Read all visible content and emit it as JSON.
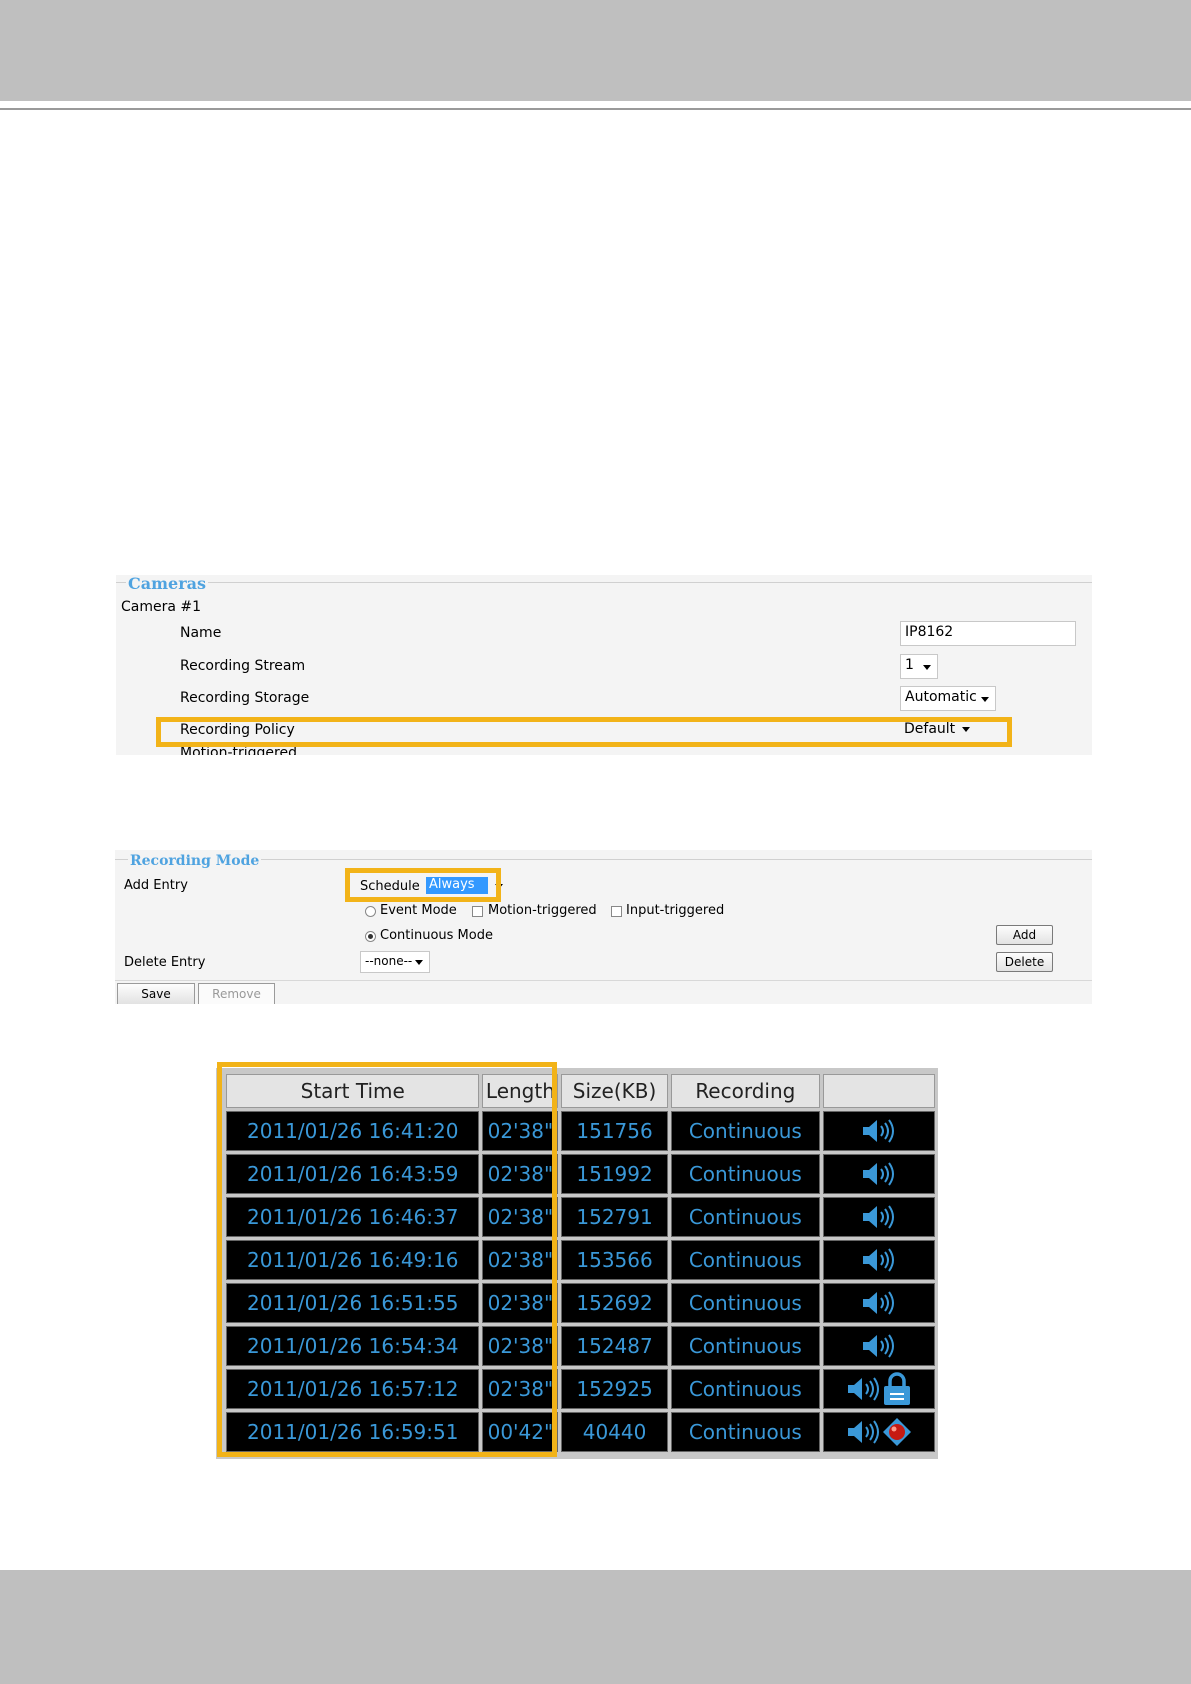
{
  "cameras_panel": {
    "legend": "Cameras",
    "camera_title": "Camera #1",
    "rows": [
      {
        "label": "Name",
        "value": "IP8162"
      },
      {
        "label": "Recording Stream",
        "value": "1"
      },
      {
        "label": "Recording Storage",
        "value": "Automatic"
      },
      {
        "label": "Recording Policy",
        "value": "Default"
      }
    ],
    "cut_off_text": "Motion-triggered"
  },
  "recording_mode_panel": {
    "legend": "Recording Mode",
    "add_entry_label": "Add Entry",
    "schedule_label": "Schedule",
    "schedule_value": "Always",
    "event_mode_label": "Event Mode",
    "motion_triggered_label": "Motion-triggered",
    "input_triggered_label": "Input-triggered",
    "continuous_mode_label": "Continuous Mode",
    "delete_entry_label": "Delete Entry",
    "delete_select_value": "--none--",
    "add_button": "Add",
    "delete_button": "Delete",
    "save_tab": "Save",
    "remove_tab": "Remove"
  },
  "recordings_table": {
    "headers": [
      "Start Time",
      "Length",
      "Size(KB)",
      "Recording",
      ""
    ],
    "rows": [
      {
        "start_time": "2011/01/26 16:41:20",
        "length": "02'38\"",
        "size_kb": "151756",
        "recording": "Continuous",
        "icons": [
          "speaker-icon"
        ]
      },
      {
        "start_time": "2011/01/26 16:43:59",
        "length": "02'38\"",
        "size_kb": "151992",
        "recording": "Continuous",
        "icons": [
          "speaker-icon"
        ]
      },
      {
        "start_time": "2011/01/26 16:46:37",
        "length": "02'38\"",
        "size_kb": "152791",
        "recording": "Continuous",
        "icons": [
          "speaker-icon"
        ]
      },
      {
        "start_time": "2011/01/26 16:49:16",
        "length": "02'38\"",
        "size_kb": "153566",
        "recording": "Continuous",
        "icons": [
          "speaker-icon"
        ]
      },
      {
        "start_time": "2011/01/26 16:51:55",
        "length": "02'38\"",
        "size_kb": "152692",
        "recording": "Continuous",
        "icons": [
          "speaker-icon"
        ]
      },
      {
        "start_time": "2011/01/26 16:54:34",
        "length": "02'38\"",
        "size_kb": "152487",
        "recording": "Continuous",
        "icons": [
          "speaker-icon"
        ]
      },
      {
        "start_time": "2011/01/26 16:57:12",
        "length": "02'38\"",
        "size_kb": "152925",
        "recording": "Continuous",
        "icons": [
          "speaker-icon",
          "lock-icon"
        ]
      },
      {
        "start_time": "2011/01/26 16:59:51",
        "length": "00'42\"",
        "size_kb": "40440",
        "recording": "Continuous",
        "icons": [
          "speaker-icon",
          "recording-dot-icon"
        ]
      }
    ]
  },
  "colors": {
    "highlight": "#f2b318",
    "legend_blue": "#4fa3e0",
    "cell_text_blue": "#3a98d8",
    "band_gray": "#bfbfbf"
  }
}
